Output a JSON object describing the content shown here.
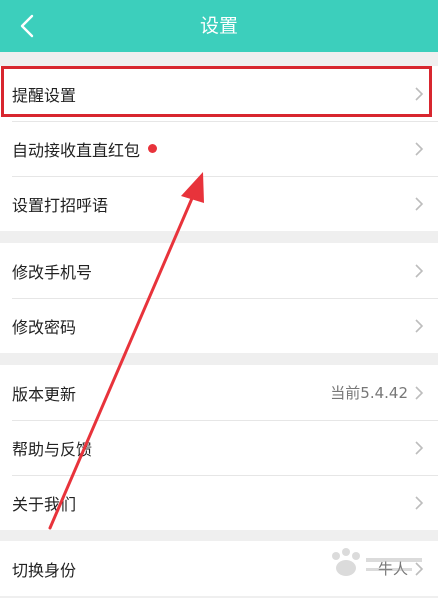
{
  "header": {
    "title": "设置",
    "back_icon": "chevron-left-icon",
    "background": "#3ccfbc"
  },
  "groups": [
    {
      "items": [
        {
          "label": "提醒设置",
          "highlighted": true
        },
        {
          "label": "自动接收直直红包",
          "badge": "red-dot"
        },
        {
          "label": "设置打招呼语"
        }
      ]
    },
    {
      "items": [
        {
          "label": "修改手机号"
        },
        {
          "label": "修改密码"
        }
      ]
    },
    {
      "items": [
        {
          "label": "版本更新",
          "value": "当前5.4.42"
        },
        {
          "label": "帮助与反馈"
        },
        {
          "label": "关于我们"
        }
      ]
    },
    {
      "items": [
        {
          "label": "切换身份",
          "value": "牛人"
        }
      ]
    }
  ],
  "annotation": {
    "color": "#e8333b",
    "highlight_color": "#d8262f"
  },
  "watermark": {
    "icon": "baidu-paw-watermark-icon"
  }
}
